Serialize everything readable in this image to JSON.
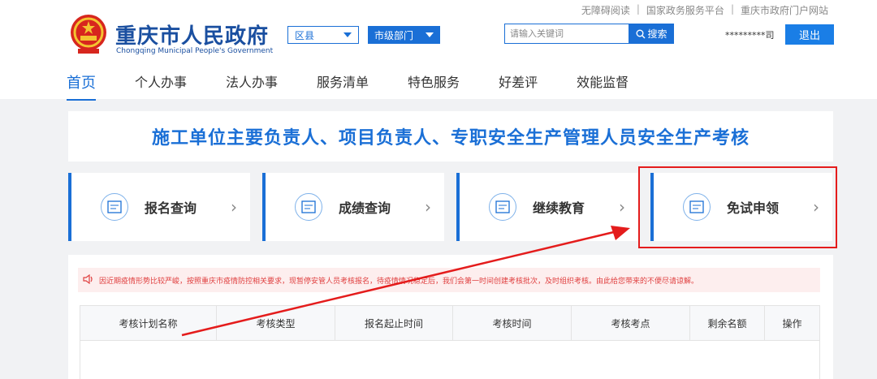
{
  "toplinks": [
    "无障碍阅读",
    "国家政务服务平台",
    "重庆市政府门户网站"
  ],
  "logo": {
    "cn": "重庆市人民政府",
    "en": "Chongqing Municipal People's Government"
  },
  "selects": {
    "county": "区县",
    "dept": "市级部门"
  },
  "search": {
    "placeholder": "请输入关键词",
    "button": "搜索"
  },
  "user": {
    "name": "*********司"
  },
  "logout": "退出",
  "nav": [
    "首页",
    "个人办事",
    "法人办事",
    "服务清单",
    "特色服务",
    "好差评",
    "效能监督"
  ],
  "page_title": "施工单位主要负责人、项目负责人、专职安全生产管理人员安全生产考核",
  "cards": [
    "报名查询",
    "成绩查询",
    "继续教育",
    "免试申领"
  ],
  "notice": "因近期疫情形势比较严峻，按照重庆市疫情防控相关要求，现暂停安管人员考核报名，待疫情情况稳定后，我们会第一时间创建考核批次，及时组织考核。由此给您带来的不便尽请谅解。",
  "table_headers": [
    "考核计划名称",
    "考核类型",
    "报名起止时间",
    "考核时间",
    "考核考点",
    "剩余名额",
    "操作"
  ],
  "colors": {
    "accent": "#1a6fd6",
    "highlight": "#e41c1c"
  }
}
